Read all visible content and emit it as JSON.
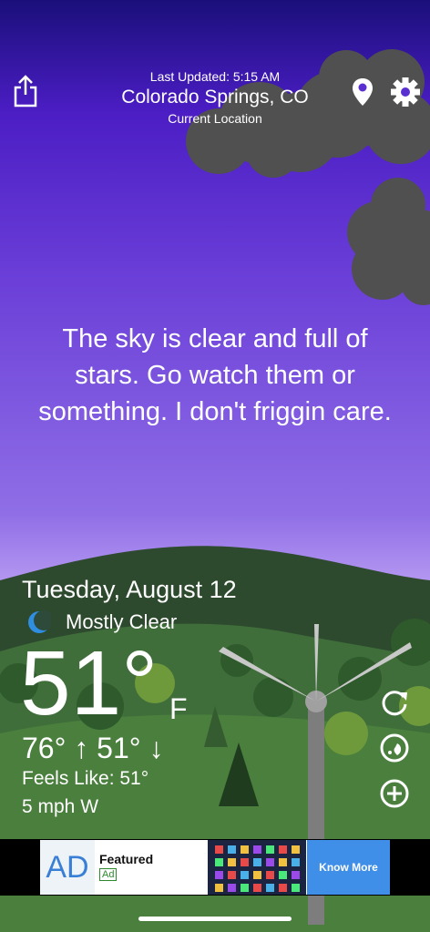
{
  "header": {
    "last_updated": "Last Updated: 5:15 AM",
    "city": "Colorado Springs, CO",
    "location_label": "Current Location"
  },
  "message": "The sky is clear and full of stars. Go watch them or something. I don't friggin care.",
  "weather": {
    "date": "Tuesday, August 12",
    "condition": "Mostly Clear",
    "temperature": "51°",
    "unit": "F",
    "high_low": "76° ↑ 51° ↓",
    "feels_like": "Feels Like: 51°",
    "wind": "5 mph W"
  },
  "ad": {
    "logo_text": "AD",
    "featured": "Featured",
    "tag": "Ad",
    "button": "Know More"
  },
  "icons": {
    "share": "share-icon",
    "location": "location-pin-icon",
    "settings": "gear-icon",
    "moon": "moon-icon",
    "refresh": "refresh-icon",
    "radar": "radar-icon",
    "add": "add-icon"
  },
  "colors": {
    "sky_top": "#1a0f7a",
    "sky_bottom": "#b79af2",
    "grass": "#3a6b3a",
    "ad_button": "#3f8ee8"
  }
}
